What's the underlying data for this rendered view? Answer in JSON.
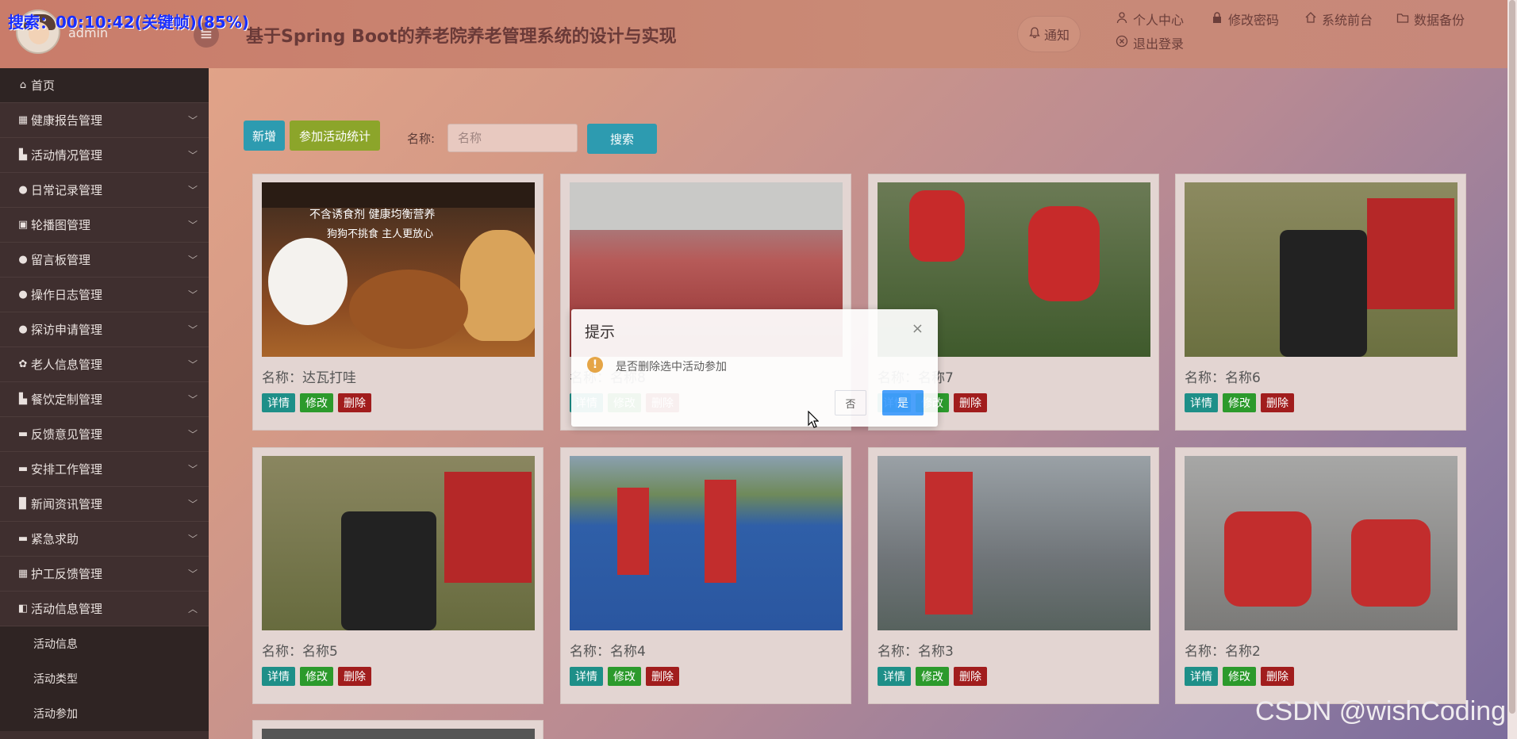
{
  "overlay": {
    "text": "搜索：00:10:42(关键帧)(85%)"
  },
  "user": {
    "name": "admin"
  },
  "header": {
    "menu_toggle": "≡",
    "title": "基于Spring Boot的养老院养老管理系统的设计与实现",
    "notify": "通知",
    "links": [
      {
        "label": "个人中心",
        "icon": "user-icon"
      },
      {
        "label": "修改密码",
        "icon": "lock-icon"
      },
      {
        "label": "系统前台",
        "icon": "home-icon"
      },
      {
        "label": "数据备份",
        "icon": "folder-icon"
      },
      {
        "label": "退出登录",
        "icon": "close-circle-icon"
      }
    ]
  },
  "sidebar": {
    "items": [
      {
        "label": "首页",
        "icon": "home-icon"
      },
      {
        "label": "健康报告管理",
        "icon": "grid-icon"
      },
      {
        "label": "活动情况管理",
        "icon": "thumb-icon"
      },
      {
        "label": "日常记录管理",
        "icon": "circle-icon"
      },
      {
        "label": "轮播图管理",
        "icon": "bag-icon"
      },
      {
        "label": "留言板管理",
        "icon": "circle-icon"
      },
      {
        "label": "操作日志管理",
        "icon": "circle-icon"
      },
      {
        "label": "探访申请管理",
        "icon": "circle-icon"
      },
      {
        "label": "老人信息管理",
        "icon": "gear-icon"
      },
      {
        "label": "餐饮定制管理",
        "icon": "bank-icon"
      },
      {
        "label": "反馈意见管理",
        "icon": "inbox-icon"
      },
      {
        "label": "安排工作管理",
        "icon": "bar-icon"
      },
      {
        "label": "新闻资讯管理",
        "icon": "book-icon"
      },
      {
        "label": "紧急求助",
        "icon": "card-icon"
      },
      {
        "label": "护工反馈管理",
        "icon": "grid-icon"
      },
      {
        "label": "活动信息管理",
        "icon": "square-icon"
      }
    ],
    "subitems": [
      "活动信息",
      "活动类型",
      "活动参加"
    ]
  },
  "toolbar": {
    "add": "新增",
    "stats": "参加活动统计",
    "name_label": "名称:",
    "search_placeholder": "名称",
    "search_btn": "搜索"
  },
  "cards": [
    {
      "name": "名称：达瓦打哇"
    },
    {
      "name": "名称：名称8"
    },
    {
      "name": "名称：名称7"
    },
    {
      "name": "名称：名称6"
    },
    {
      "name": "名称：名称5"
    },
    {
      "name": "名称：名称4"
    },
    {
      "name": "名称：名称3"
    },
    {
      "name": "名称：名称2"
    }
  ],
  "card_actions": {
    "detail": "详情",
    "edit": "修改",
    "delete": "删除"
  },
  "dialog": {
    "title": "提示",
    "close": "×",
    "warn": "!",
    "message": "是否删除选中活动参加",
    "no": "否",
    "yes": "是"
  },
  "watermark": "CSDN @wishCoding",
  "image_banner_lines": [
    "不含诱食剂 健康均衡营养",
    "狗狗不挑食 主人更放心"
  ]
}
